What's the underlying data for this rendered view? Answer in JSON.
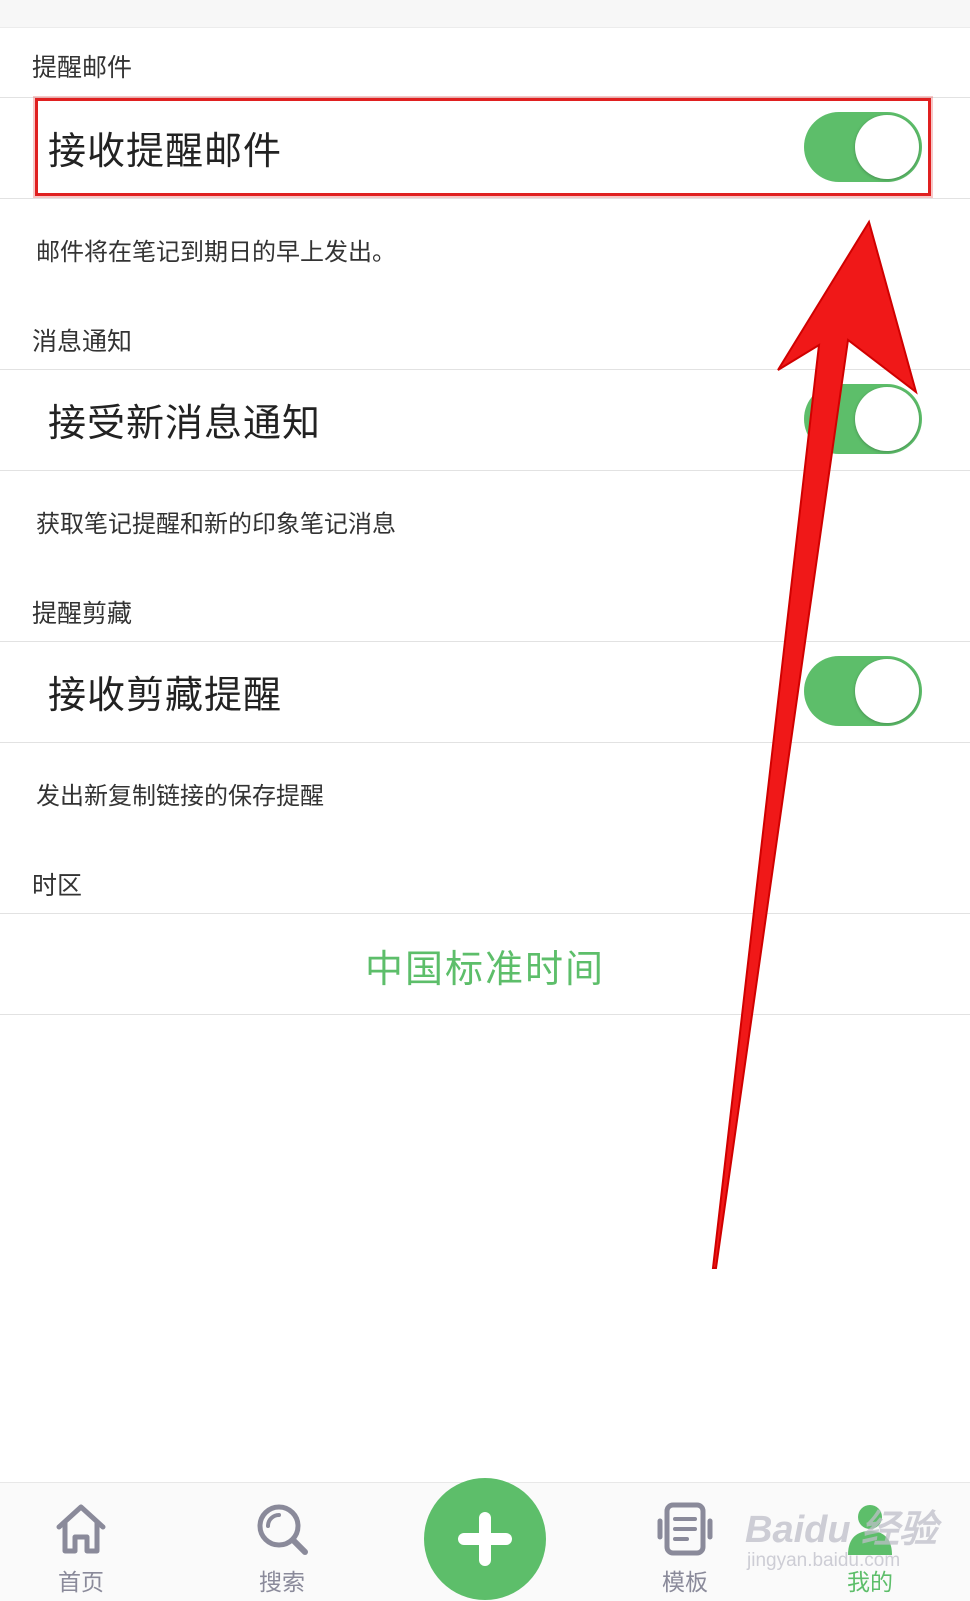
{
  "sections": {
    "reminder_email": {
      "title": "提醒邮件",
      "row_label": "接收提醒邮件",
      "toggle_on": true,
      "description": "邮件将在笔记到期日的早上发出。"
    },
    "message_notification": {
      "title": "消息通知",
      "row_label": "接受新消息通知",
      "toggle_on": true,
      "description": "获取笔记提醒和新的印象笔记消息"
    },
    "clip_reminder": {
      "title": "提醒剪藏",
      "row_label": "接收剪藏提醒",
      "toggle_on": true,
      "description": "发出新复制链接的保存提醒"
    },
    "timezone": {
      "title": "时区",
      "value": "中国标准时间"
    }
  },
  "tabbar": {
    "home": "首页",
    "search": "搜索",
    "templates": "模板",
    "mine": "我的",
    "active": "mine"
  },
  "watermark": {
    "main": "Baidu 经验",
    "sub": "jingyan.baidu.com"
  },
  "colors": {
    "accent_green": "#5dbe6a",
    "annotation_red": "#e02020",
    "tab_inactive": "#8a8a9a"
  }
}
